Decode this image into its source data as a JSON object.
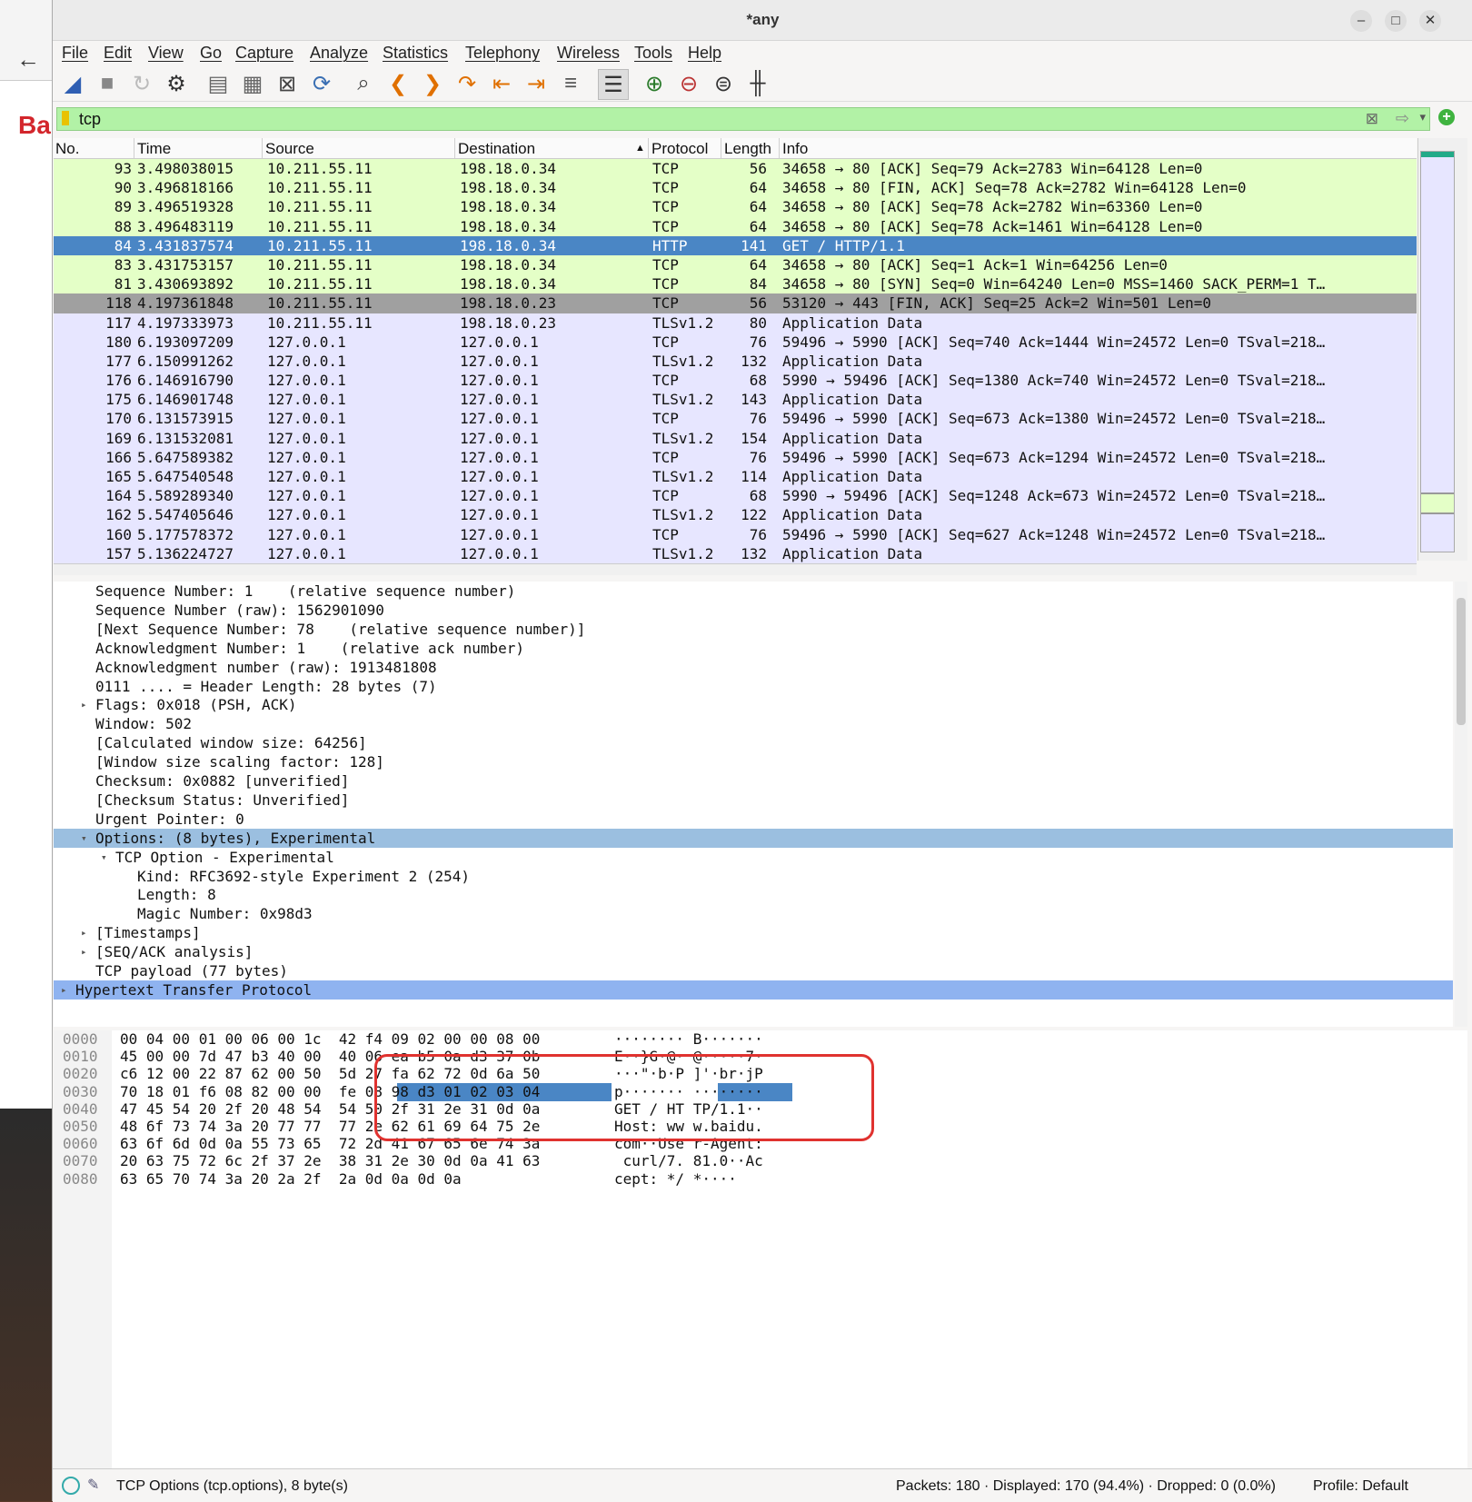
{
  "window": {
    "title": "*any"
  },
  "background": {
    "page_fragment": "Ba"
  },
  "menu": [
    "File",
    "Edit",
    "View",
    "Go",
    "Capture",
    "Analyze",
    "Statistics",
    "Telephony",
    "Wireless",
    "Tools",
    "Help"
  ],
  "toolbar_icons": [
    "shark-fin-start-icon",
    "stop-icon",
    "restart-icon",
    "options-gear-icon",
    "open-folder-icon",
    "file-set-icon",
    "close-file-icon",
    "reload-icon",
    "find-icon",
    "go-back-icon",
    "go-forward-icon",
    "go-to-packet-icon",
    "first-packet-icon",
    "last-packet-icon",
    "autoscroll-icon",
    "colorize-icon",
    "zoom-in-icon",
    "zoom-out-icon",
    "normal-size-icon",
    "resize-columns-icon"
  ],
  "filter": {
    "value": "tcp"
  },
  "columns": [
    "No.",
    "Time",
    "Source",
    "Destination",
    "Protocol",
    "Length",
    "Info"
  ],
  "packets": [
    {
      "no": "93",
      "time": "3.498038015",
      "src": "10.211.55.11",
      "dst": "198.18.0.34",
      "proto": "TCP",
      "len": "56",
      "info": "34658 → 80 [ACK] Seq=79 Ack=2783 Win=64128 Len=0",
      "style": "g"
    },
    {
      "no": "90",
      "time": "3.496818166",
      "src": "10.211.55.11",
      "dst": "198.18.0.34",
      "proto": "TCP",
      "len": "64",
      "info": "34658 → 80 [FIN, ACK] Seq=78 Ack=2782 Win=64128 Len=0",
      "style": "g"
    },
    {
      "no": "89",
      "time": "3.496519328",
      "src": "10.211.55.11",
      "dst": "198.18.0.34",
      "proto": "TCP",
      "len": "64",
      "info": "34658 → 80 [ACK] Seq=78 Ack=2782 Win=63360 Len=0",
      "style": "g"
    },
    {
      "no": "88",
      "time": "3.496483119",
      "src": "10.211.55.11",
      "dst": "198.18.0.34",
      "proto": "TCP",
      "len": "64",
      "info": "34658 → 80 [ACK] Seq=78 Ack=1461 Win=64128 Len=0",
      "style": "g"
    },
    {
      "no": "84",
      "time": "3.431837574",
      "src": "10.211.55.11",
      "dst": "198.18.0.34",
      "proto": "HTTP",
      "len": "141",
      "info": "GET / HTTP/1.1",
      "style": "sel"
    },
    {
      "no": "83",
      "time": "3.431753157",
      "src": "10.211.55.11",
      "dst": "198.18.0.34",
      "proto": "TCP",
      "len": "64",
      "info": "34658 → 80 [ACK] Seq=1 Ack=1 Win=64256 Len=0",
      "style": "g"
    },
    {
      "no": "81",
      "time": "3.430693892",
      "src": "10.211.55.11",
      "dst": "198.18.0.34",
      "proto": "TCP",
      "len": "84",
      "info": "34658 → 80 [SYN] Seq=0 Win=64240 Len=0 MSS=1460 SACK_PERM=1 T…",
      "style": "g"
    },
    {
      "no": "118",
      "time": "4.197361848",
      "src": "10.211.55.11",
      "dst": "198.18.0.23",
      "proto": "TCP",
      "len": "56",
      "info": "53120 → 443 [FIN, ACK] Seq=25 Ack=2 Win=501 Len=0",
      "style": "dk"
    },
    {
      "no": "117",
      "time": "4.197333973",
      "src": "10.211.55.11",
      "dst": "198.18.0.23",
      "proto": "TLSv1.2",
      "len": "80",
      "info": "Application Data",
      "style": "b"
    },
    {
      "no": "180",
      "time": "6.193097209",
      "src": "127.0.0.1",
      "dst": "127.0.0.1",
      "proto": "TCP",
      "len": "76",
      "info": "59496 → 5990 [ACK] Seq=740 Ack=1444 Win=24572 Len=0 TSval=218…",
      "style": "b"
    },
    {
      "no": "177",
      "time": "6.150991262",
      "src": "127.0.0.1",
      "dst": "127.0.0.1",
      "proto": "TLSv1.2",
      "len": "132",
      "info": "Application Data",
      "style": "b"
    },
    {
      "no": "176",
      "time": "6.146916790",
      "src": "127.0.0.1",
      "dst": "127.0.0.1",
      "proto": "TCP",
      "len": "68",
      "info": "5990 → 59496 [ACK] Seq=1380 Ack=740 Win=24572 Len=0 TSval=218…",
      "style": "b"
    },
    {
      "no": "175",
      "time": "6.146901748",
      "src": "127.0.0.1",
      "dst": "127.0.0.1",
      "proto": "TLSv1.2",
      "len": "143",
      "info": "Application Data",
      "style": "b"
    },
    {
      "no": "170",
      "time": "6.131573915",
      "src": "127.0.0.1",
      "dst": "127.0.0.1",
      "proto": "TCP",
      "len": "76",
      "info": "59496 → 5990 [ACK] Seq=673 Ack=1380 Win=24572 Len=0 TSval=218…",
      "style": "b"
    },
    {
      "no": "169",
      "time": "6.131532081",
      "src": "127.0.0.1",
      "dst": "127.0.0.1",
      "proto": "TLSv1.2",
      "len": "154",
      "info": "Application Data",
      "style": "b"
    },
    {
      "no": "166",
      "time": "5.647589382",
      "src": "127.0.0.1",
      "dst": "127.0.0.1",
      "proto": "TCP",
      "len": "76",
      "info": "59496 → 5990 [ACK] Seq=673 Ack=1294 Win=24572 Len=0 TSval=218…",
      "style": "b"
    },
    {
      "no": "165",
      "time": "5.647540548",
      "src": "127.0.0.1",
      "dst": "127.0.0.1",
      "proto": "TLSv1.2",
      "len": "114",
      "info": "Application Data",
      "style": "b"
    },
    {
      "no": "164",
      "time": "5.589289340",
      "src": "127.0.0.1",
      "dst": "127.0.0.1",
      "proto": "TCP",
      "len": "68",
      "info": "5990 → 59496 [ACK] Seq=1248 Ack=673 Win=24572 Len=0 TSval=218…",
      "style": "b"
    },
    {
      "no": "162",
      "time": "5.547405646",
      "src": "127.0.0.1",
      "dst": "127.0.0.1",
      "proto": "TLSv1.2",
      "len": "122",
      "info": "Application Data",
      "style": "b"
    },
    {
      "no": "160",
      "time": "5.177578372",
      "src": "127.0.0.1",
      "dst": "127.0.0.1",
      "proto": "TCP",
      "len": "76",
      "info": "59496 → 5990 [ACK] Seq=627 Ack=1248 Win=24572 Len=0 TSval=218…",
      "style": "b"
    },
    {
      "no": "157",
      "time": "5.136224727",
      "src": "127.0.0.1",
      "dst": "127.0.0.1",
      "proto": "TLSv1.2",
      "len": "132",
      "info": "Application Data",
      "style": "b"
    }
  ],
  "details": [
    {
      "text": "Sequence Number: 1    (relative sequence number)",
      "indent": 2,
      "arrow": ""
    },
    {
      "text": "Sequence Number (raw): 1562901090",
      "indent": 2,
      "arrow": ""
    },
    {
      "text": "[Next Sequence Number: 78    (relative sequence number)]",
      "indent": 2,
      "arrow": ""
    },
    {
      "text": "Acknowledgment Number: 1    (relative ack number)",
      "indent": 2,
      "arrow": ""
    },
    {
      "text": "Acknowledgment number (raw): 1913481808",
      "indent": 2,
      "arrow": ""
    },
    {
      "text": "0111 .... = Header Length: 28 bytes (7)",
      "indent": 2,
      "arrow": ""
    },
    {
      "text": "Flags: 0x018 (PSH, ACK)",
      "indent": 2,
      "arrow": "collapsed"
    },
    {
      "text": "Window: 502",
      "indent": 2,
      "arrow": ""
    },
    {
      "text": "[Calculated window size: 64256]",
      "indent": 2,
      "arrow": ""
    },
    {
      "text": "[Window size scaling factor: 128]",
      "indent": 2,
      "arrow": ""
    },
    {
      "text": "Checksum: 0x0882 [unverified]",
      "indent": 2,
      "arrow": ""
    },
    {
      "text": "[Checksum Status: Unverified]",
      "indent": 2,
      "arrow": ""
    },
    {
      "text": "Urgent Pointer: 0",
      "indent": 2,
      "arrow": ""
    },
    {
      "text": "Options: (8 bytes), Experimental",
      "indent": 2,
      "arrow": "expanded",
      "style": "sel"
    },
    {
      "text": "TCP Option - Experimental",
      "indent": 3,
      "arrow": "expanded"
    },
    {
      "text": "Kind: RFC3692-style Experiment 2 (254)",
      "indent": 4,
      "arrow": ""
    },
    {
      "text": "Length: 8",
      "indent": 4,
      "arrow": ""
    },
    {
      "text": "Magic Number: 0x98d3",
      "indent": 4,
      "arrow": ""
    },
    {
      "text": "[Timestamps]",
      "indent": 2,
      "arrow": "collapsed"
    },
    {
      "text": "[SEQ/ACK analysis]",
      "indent": 2,
      "arrow": "collapsed"
    },
    {
      "text": "TCP payload (77 bytes)",
      "indent": 2,
      "arrow": ""
    },
    {
      "text": "Hypertext Transfer Protocol",
      "indent": 1,
      "arrow": "collapsed",
      "style": "hl"
    }
  ],
  "bytes": [
    {
      "off": "0000",
      "hex": "00 04 00 01 00 06 00 1c  42 f4 09 02 00 00 08 00",
      "ascii": "········ B·······"
    },
    {
      "off": "0010",
      "hex": "45 00 00 7d 47 b3 40 00  40 06 ea b5 0a d3 37 0b",
      "ascii": "E··}G·@· @·····7·"
    },
    {
      "off": "0020",
      "hex": "c6 12 00 22 87 62 00 50  5d 27 fa 62 72 0d 6a 50",
      "ascii": "···\"·b·P ]'·br·jP"
    },
    {
      "off": "0030",
      "hex": "70 18 01 f6 08 82 00 00  fe 08 98 d3 01 02 03 04",
      "ascii": "p······· ········"
    },
    {
      "off": "0040",
      "hex": "47 45 54 20 2f 20 48 54  54 50 2f 31 2e 31 0d 0a",
      "ascii": "GET / HT TP/1.1··"
    },
    {
      "off": "0050",
      "hex": "48 6f 73 74 3a 20 77 77  77 2e 62 61 69 64 75 2e",
      "ascii": "Host: ww w.baidu."
    },
    {
      "off": "0060",
      "hex": "63 6f 6d 0d 0a 55 73 65  72 2d 41 67 65 6e 74 3a",
      "ascii": "com··Use r-Agent:"
    },
    {
      "off": "0070",
      "hex": "20 63 75 72 6c 2f 37 2e  38 31 2e 30 0d 0a 41 63",
      "ascii": " curl/7. 81.0··Ac"
    },
    {
      "off": "0080",
      "hex": "63 65 70 74 3a 20 2a 2f  2a 0d 0a 0d 0a",
      "ascii": "cept: */ *····"
    }
  ],
  "status": {
    "field": "TCP Options (tcp.options), 8 byte(s)",
    "counts": "Packets: 180 · Displayed: 170 (94.4%) · Dropped: 0 (0.0%)",
    "profile": "Profile: Default"
  },
  "colors": {
    "selected": "#4a86c5",
    "tcp_row": "#e4ffc7",
    "tls_row": "#e7e6ff",
    "filter_ok": "#b2f2a6",
    "annotation": "#e0322f"
  }
}
